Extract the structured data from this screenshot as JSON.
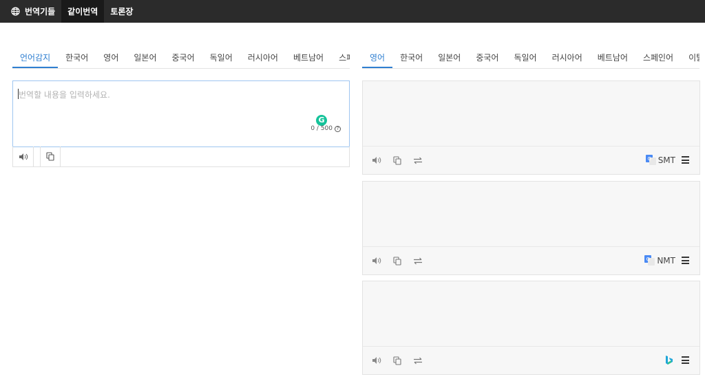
{
  "nav": {
    "items": [
      {
        "label": "번역기들",
        "icon": "globe-icon"
      },
      {
        "label": "같이번역"
      },
      {
        "label": "토론장"
      }
    ]
  },
  "source": {
    "tabs": [
      {
        "label": "언어감지"
      },
      {
        "label": "한국어"
      },
      {
        "label": "영어"
      },
      {
        "label": "일본어"
      },
      {
        "label": "중국어"
      },
      {
        "label": "독일어"
      },
      {
        "label": "러시아어"
      },
      {
        "label": "베트남어"
      },
      {
        "label": "스페"
      }
    ],
    "placeholder": "번역할 내용을 입력하세요.",
    "counter": "0 / 500",
    "grammarly": "G"
  },
  "target": {
    "tabs": [
      {
        "label": "영어"
      },
      {
        "label": "한국어"
      },
      {
        "label": "일본어"
      },
      {
        "label": "중국어"
      },
      {
        "label": "독일어"
      },
      {
        "label": "러시아어"
      },
      {
        "label": "베트남어"
      },
      {
        "label": "스페인어"
      },
      {
        "label": "이탈"
      }
    ],
    "panels": [
      {
        "engine_label": "SMT",
        "engine_icon": "google-translate-icon"
      },
      {
        "engine_label": "NMT",
        "engine_icon": "google-translate-icon"
      },
      {
        "engine_label": "",
        "engine_icon": "bing-icon"
      }
    ]
  },
  "colors": {
    "accent": "#2f7fd1",
    "topbar": "#2b2b2b",
    "grammarly": "#15c39a"
  }
}
